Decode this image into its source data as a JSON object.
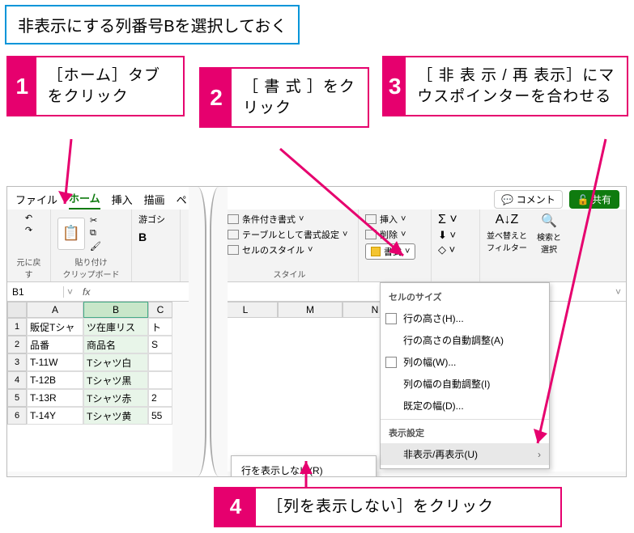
{
  "instruction": "非表示にする列番号Bを選択しておく",
  "callouts": {
    "c1": {
      "num": "1",
      "text": "［ホーム］タブをクリック"
    },
    "c2": {
      "num": "2",
      "text": "［ 書 式 ］をクリック"
    },
    "c3": {
      "num": "3",
      "text": "［ 非 表 示 / 再 表示］にマウスポインターを合わせる"
    },
    "c4": {
      "num": "4",
      "text": "［列を表示しない］をクリック"
    }
  },
  "ribbon": {
    "tabs": {
      "file": "ファイル",
      "home": "ホーム",
      "insert": "挿入",
      "draw": "描画",
      "pe": "ペ"
    },
    "comment": "コメント",
    "share": "共有",
    "undo_group": "元に戻す",
    "clipboard": {
      "paste": "貼り付け",
      "label": "クリップボード"
    },
    "font": {
      "name": "游ゴシ",
      "bold": "B"
    },
    "styles": {
      "cond": "条件付き書式",
      "table": "テーブルとして書式設定",
      "cell": "セルのスタイル",
      "label": "スタイル"
    },
    "cells": {
      "insert": "挿入",
      "delete": "削除",
      "format": "書式"
    },
    "editing": {
      "sort": "並べ替えと\nフィルター",
      "find": "検索と\n選択"
    }
  },
  "namebox": "B1",
  "sheet": {
    "col_headers": [
      "A",
      "B",
      "C"
    ],
    "wide_headers": [
      "L",
      "M",
      "N"
    ],
    "rows": [
      {
        "n": "1",
        "a": "販促Tシャ",
        "b": "ツ在庫リス",
        "c": "ト"
      },
      {
        "n": "2",
        "a": "品番",
        "b": "商品名",
        "c": "S"
      },
      {
        "n": "3",
        "a": "T-11W",
        "b": "Tシャツ白",
        "c": ""
      },
      {
        "n": "4",
        "a": "T-12B",
        "b": "Tシャツ黒",
        "c": ""
      },
      {
        "n": "5",
        "a": "T-13R",
        "b": "Tシャツ赤",
        "c": "2"
      },
      {
        "n": "6",
        "a": "T-14Y",
        "b": "Tシャツ黄",
        "c": "55"
      }
    ]
  },
  "dropdown": {
    "size_section": "セルのサイズ",
    "row_height": "行の高さ(H)...",
    "row_auto": "行の高さの自動調整(A)",
    "col_width": "列の幅(W)...",
    "col_auto": "列の幅の自動調整(I)",
    "default_width": "既定の幅(D)...",
    "display_section": "表示設定",
    "hide_unhide": "非表示/再表示(U)"
  },
  "flyout": {
    "hide_rows": "行を表示しない(R)"
  }
}
